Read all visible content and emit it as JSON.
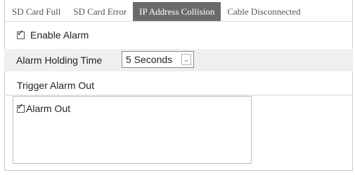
{
  "tabs": [
    {
      "label": "SD Card Full",
      "active": false
    },
    {
      "label": "SD Card Error",
      "active": false
    },
    {
      "label": "IP Address Collision",
      "active": true
    },
    {
      "label": "Cable Disconnected",
      "active": false
    }
  ],
  "enable_alarm": {
    "label": "Enable Alarm",
    "checked": true
  },
  "holding_time": {
    "label": "Alarm Holding Time",
    "value": "5 Seconds"
  },
  "trigger": {
    "label": "Trigger Alarm Out"
  },
  "alarm_out": {
    "label": "Alarm Out",
    "checked": true
  },
  "colors": {
    "active_tab_bg": "#6b6b6b",
    "row_bg": "#efefef"
  }
}
